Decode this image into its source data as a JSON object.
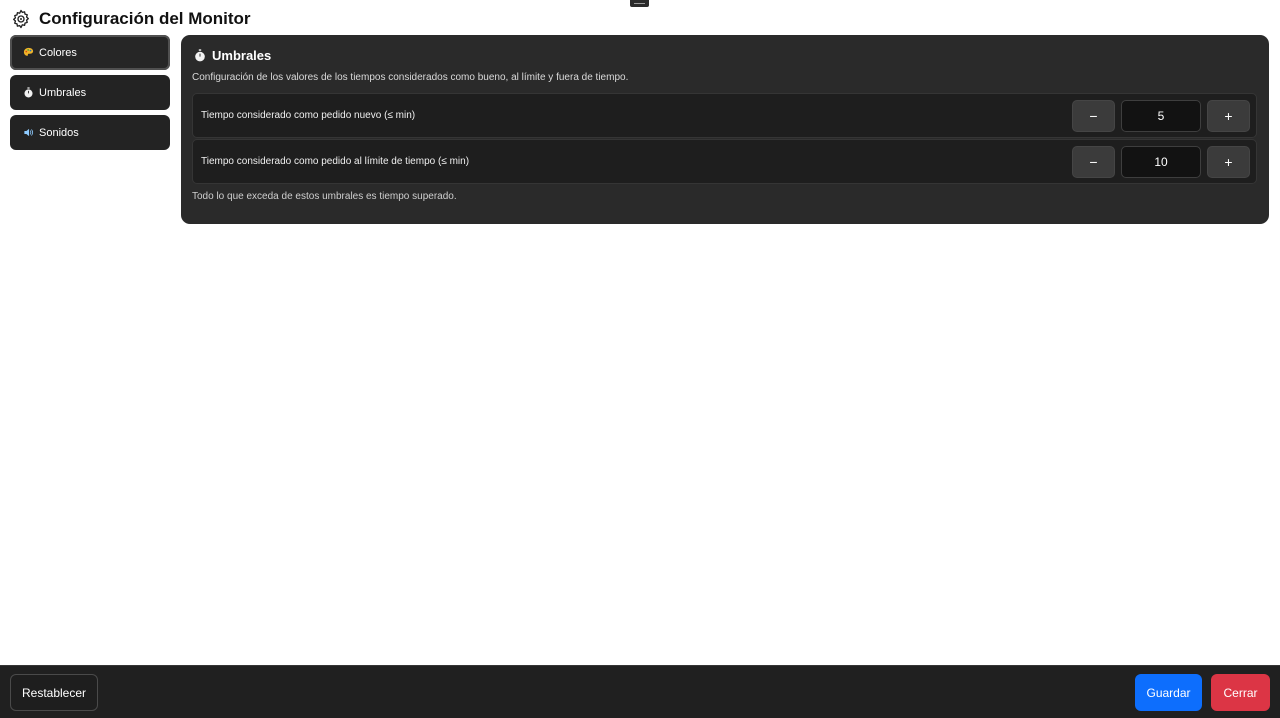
{
  "header": {
    "title": "Configuración del Monitor",
    "icon": "gear-icon"
  },
  "sidebar": {
    "items": [
      {
        "label": "Colores",
        "icon": "palette-icon",
        "active": true
      },
      {
        "label": "Umbrales",
        "icon": "stopwatch-icon",
        "active": false
      },
      {
        "label": "Sonidos",
        "icon": "speaker-icon",
        "active": false
      }
    ]
  },
  "panel": {
    "title": "Umbrales",
    "icon": "stopwatch-icon",
    "description": "Configuración de los valores de los tiempos considerados como bueno, al límite y fuera de tiempo.",
    "rows": [
      {
        "label": "Tiempo considerado como pedido nuevo (≤ min)",
        "value": "5",
        "decrement": "−",
        "increment": "+"
      },
      {
        "label": "Tiempo considerado como pedido al límite de tiempo (≤ min)",
        "value": "10",
        "decrement": "−",
        "increment": "+"
      }
    ],
    "note": "Todo lo que exceda de estos umbrales es tiempo superado."
  },
  "footer": {
    "reset_label": "Restablecer",
    "save_label": "Guardar",
    "close_label": "Cerrar"
  },
  "colors": {
    "save": "#0d6efd",
    "close": "#dc3545",
    "panel_bg": "#2a2a2a"
  }
}
